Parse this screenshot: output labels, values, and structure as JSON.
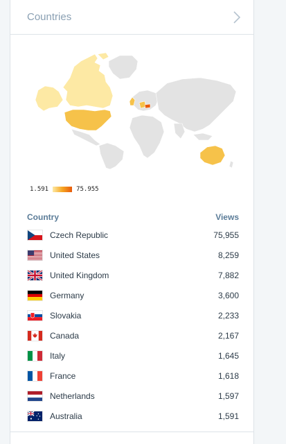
{
  "panel": {
    "title": "Countries"
  },
  "map": {
    "legend_min": "1.591",
    "legend_max": "75.955",
    "colors": {
      "base": "#e3e3e3",
      "low": "#fde9a4",
      "mid": "#f6c24a",
      "high": "#e85b0c"
    }
  },
  "table": {
    "col_country": "Country",
    "col_views": "Views",
    "rows": [
      {
        "country": "Czech Republic",
        "views": "75,955",
        "flag": "cz-flag-icon"
      },
      {
        "country": "United States",
        "views": "8,259",
        "flag": "us-flag-icon"
      },
      {
        "country": "United Kingdom",
        "views": "7,882",
        "flag": "gb-flag-icon"
      },
      {
        "country": "Germany",
        "views": "3,600",
        "flag": "de-flag-icon"
      },
      {
        "country": "Slovakia",
        "views": "2,233",
        "flag": "sk-flag-icon"
      },
      {
        "country": "Canada",
        "views": "2,167",
        "flag": "ca-flag-icon"
      },
      {
        "country": "Italy",
        "views": "1,645",
        "flag": "it-flag-icon"
      },
      {
        "country": "France",
        "views": "1,618",
        "flag": "fr-flag-icon"
      },
      {
        "country": "Netherlands",
        "views": "1,597",
        "flag": "nl-flag-icon"
      },
      {
        "country": "Australia",
        "views": "1,591",
        "flag": "au-flag-icon"
      }
    ]
  }
}
